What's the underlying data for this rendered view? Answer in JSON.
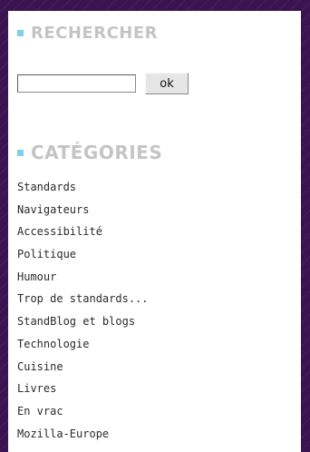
{
  "search": {
    "title": "RECHERCHER",
    "input_value": "",
    "button_label": "ok"
  },
  "categories": {
    "title": "CATÉGORIES",
    "items": [
      "Standards",
      "Navigateurs",
      "Accessibilité",
      "Politique",
      "Humour",
      "Trop de standards...",
      "StandBlog et blogs",
      "Technologie",
      "Cuisine",
      "Livres",
      "En vrac",
      "Mozilla-Europe"
    ]
  },
  "colors": {
    "background": "#3a1450",
    "panel": "#ffffff",
    "heading": "#c4c4c4",
    "bullet": "#7fcfee"
  }
}
